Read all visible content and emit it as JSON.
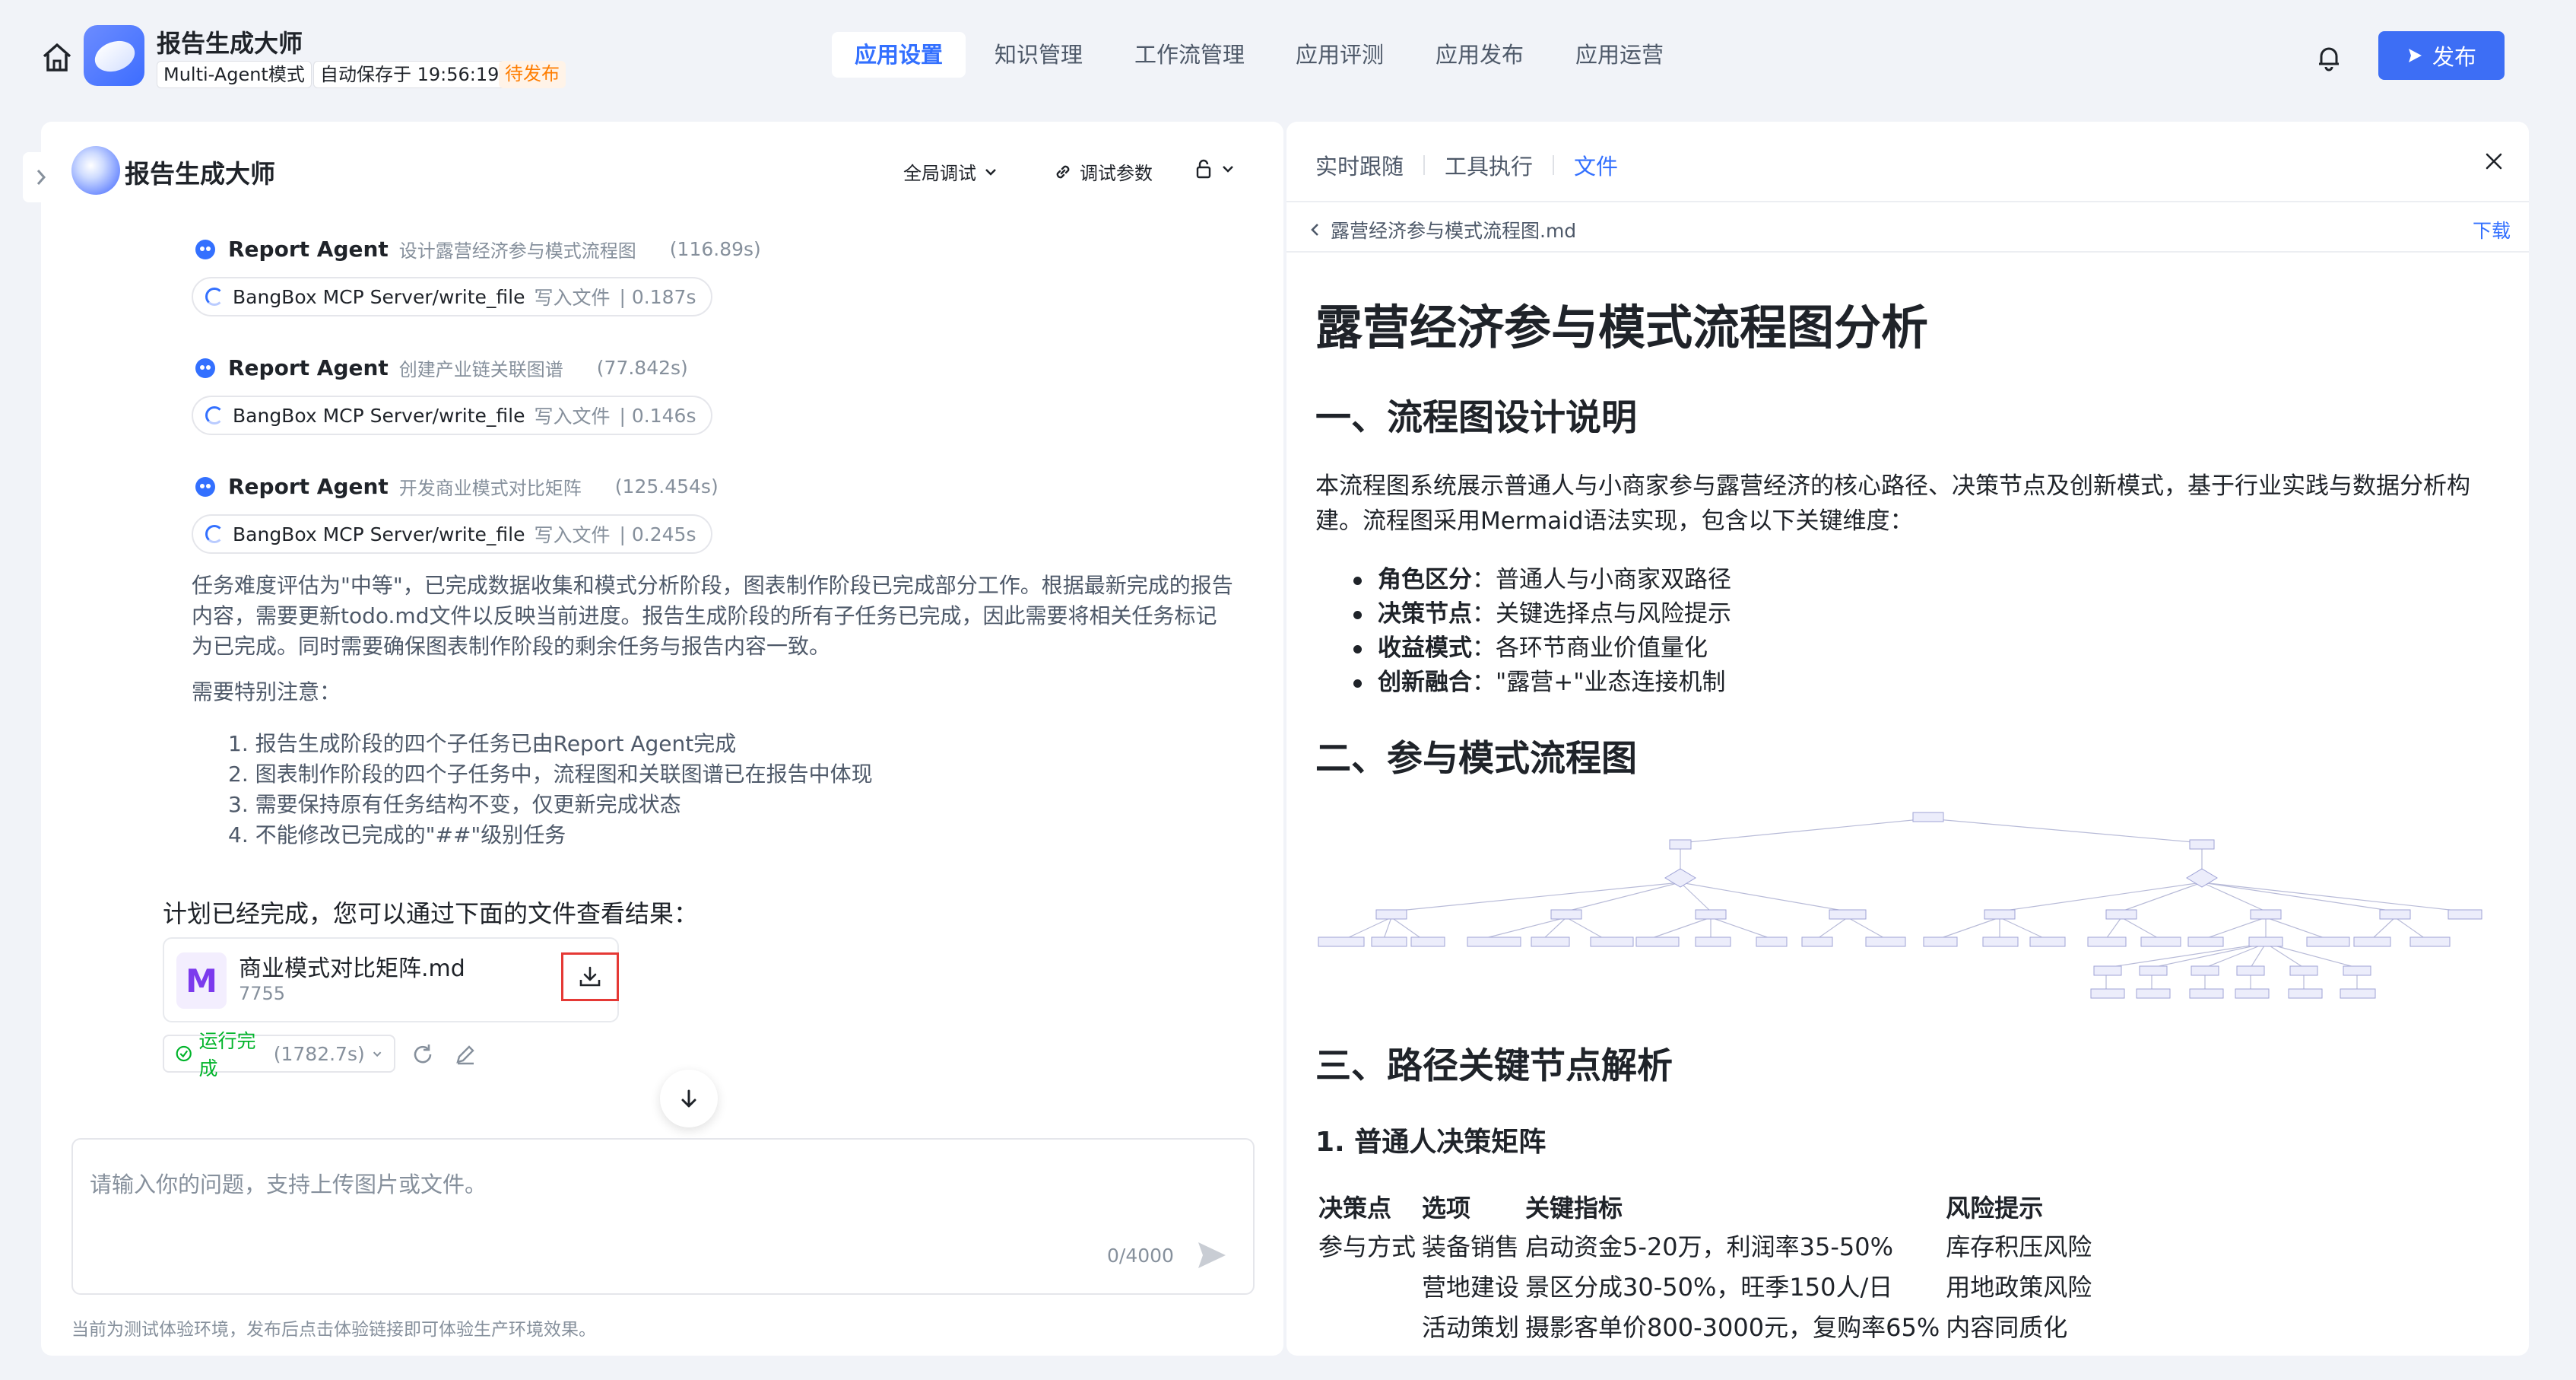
{
  "app": {
    "title": "报告生成大师",
    "mode_tag": "Multi-Agent模式",
    "autosave": "自动保存于 19:56:19",
    "status": "待发布"
  },
  "nav": {
    "tabs": [
      {
        "label": "应用设置",
        "active": true
      },
      {
        "label": "知识管理"
      },
      {
        "label": "工作流管理"
      },
      {
        "label": "应用评测"
      },
      {
        "label": "应用发布"
      },
      {
        "label": "应用运营"
      }
    ],
    "publish_label": "发布"
  },
  "chat": {
    "title": "报告生成大师",
    "global_debug": "全局调试",
    "debug_params": "调试参数",
    "agents": [
      {
        "name": "Report Agent",
        "desc": "设计露营经济参与模式流程图",
        "time": "(116.89s)",
        "tool": "BangBox MCP Server/write_file",
        "tool_action": "写入文件",
        "tool_time": "| 0.187s"
      },
      {
        "name": "Report Agent",
        "desc": "创建产业链关联图谱",
        "time": "(77.842s)",
        "tool": "BangBox MCP Server/write_file",
        "tool_action": "写入文件",
        "tool_time": "| 0.146s"
      },
      {
        "name": "Report Agent",
        "desc": "开发商业模式对比矩阵",
        "time": "(125.454s)",
        "tool": "BangBox MCP Server/write_file",
        "tool_action": "写入文件",
        "tool_time": "| 0.245s"
      }
    ],
    "paragraph": "任务难度评估为\"中等\"，已完成数据收集和模式分析阶段，图表制作阶段已完成部分工作。根据最新完成的报告内容，需要更新todo.md文件以反映当前进度。报告生成阶段的所有子任务已完成，因此需要将相关任务标记为已完成。同时需要确保图表制作阶段的剩余任务与报告内容一致。",
    "note_title": "需要特别注意：",
    "notes": [
      "1. 报告生成阶段的四个子任务已由Report Agent完成",
      "2. 图表制作阶段的四个子任务中，流程图和关联图谱已在报告中体现",
      "3. 需要保持原有任务结构不变，仅更新完成状态",
      "4. 不能修改已完成的\"##\"级别任务"
    ],
    "plan_done": "计划已经完成，您可以通过下面的文件查看结果：",
    "file": {
      "name": "商业模式对比矩阵.md",
      "size": "7755",
      "icon_letter": "M"
    },
    "run_status": "运行完成",
    "run_time": "(1782.7s)",
    "input_placeholder": "请输入你的问题，支持上传图片或文件。",
    "counter": "0/4000",
    "footnote": "当前为测试体验环境，发布后点击体验链接即可体验生产环境效果。"
  },
  "preview": {
    "tabs": [
      "实时跟随",
      "工具执行",
      "文件"
    ],
    "active_tab": "文件",
    "file_path": "露营经济参与模式流程图.md",
    "download": "下载",
    "h1": "露营经济参与模式流程图分析",
    "sec1": "一、流程图设计说明",
    "sec1_para": "本流程图系统展示普通人与小商家参与露营经济的核心路径、决策节点及创新模式，基于行业实践与数据分析构建。流程图采用Mermaid语法实现，包含以下关键维度：",
    "bullets": [
      {
        "key": "角色区分",
        "val": "：普通人与小商家双路径"
      },
      {
        "key": "决策节点",
        "val": "：关键选择点与风险提示"
      },
      {
        "key": "收益模式",
        "val": "：各环节商业价值量化"
      },
      {
        "key": "创新融合",
        "val": "：\"露营+\"业态连接机制"
      }
    ],
    "sec2": "二、参与模式流程图",
    "sec3": "三、路径关键节点解析",
    "sub1": "1. 普通人决策矩阵",
    "table": {
      "headers": [
        "决策点",
        "选项",
        "关键指标",
        "风险提示"
      ],
      "rows": [
        [
          "参与方式",
          "装备销售",
          "启动资金5-20万，利润率35-50%",
          "库存积压风险"
        ],
        [
          "",
          "营地建设",
          "景区分成30-50%，旺季150人/日",
          "用地政策风险"
        ],
        [
          "",
          "活动策划",
          "摄影客单价800-3000元，复购率65%",
          "内容同质化"
        ]
      ]
    }
  },
  "colors": {
    "accent": "#3370ff",
    "publish": "#3d6ef5",
    "warn": "#ff7d00",
    "success": "#00b42a",
    "highlight": "#e53935"
  }
}
